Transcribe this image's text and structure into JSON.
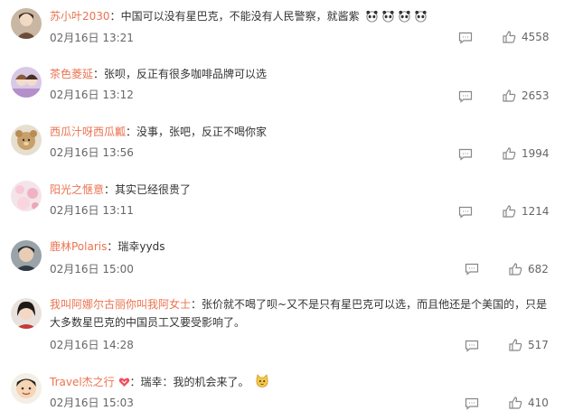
{
  "comments": [
    {
      "user": "苏小叶2030",
      "text": "中国可以没有星巴克，不能没有人民警察，就酱紫",
      "text2": "",
      "date": "02月16日 13:21",
      "likes": "4558",
      "emoji_count": 4,
      "emoji": "panda-emoji"
    },
    {
      "user": "茶色菱延",
      "text": "张呗，反正有很多咖啡品牌可以选",
      "text2": "",
      "date": "02月16日 13:12",
      "likes": "2653",
      "emoji_count": 0
    },
    {
      "user": "西瓜汁呀西瓜瓤",
      "text": "没事，张吧，反正不喝你家",
      "text2": "",
      "date": "02月16日 13:56",
      "likes": "1994",
      "emoji_count": 0
    },
    {
      "user": "阳光之惬意",
      "text": "其实已经很贵了",
      "text2": "",
      "date": "02月16日 13:11",
      "likes": "1214",
      "emoji_count": 0
    },
    {
      "user": "鹿林Polaris",
      "text": "瑞幸yyds",
      "text2": "",
      "date": "02月16日 15:00",
      "likes": "682",
      "emoji_count": 0
    },
    {
      "user": "我叫阿娜尔古丽你叫我阿女士",
      "text": "张价就不喝了呗~又不是只有星巴克可以选，而且他还是个美国的，只是",
      "text2": "大多数星巴克的中国员工又要受影响了。",
      "date": "02月16日 14:28",
      "likes": "517",
      "emoji_count": 0
    },
    {
      "user": "Travel杰之行",
      "text": "瑞幸：我的机会来了。",
      "text2": "",
      "date": "02月16日 15:03",
      "likes": "410",
      "emoji_count": 1,
      "emoji": "cat-emoji",
      "badge": "vip-heart-badge"
    }
  ],
  "separator": "：",
  "icons": {
    "reply": "comment-icon",
    "like": "thumbs-up-icon"
  },
  "colors": {
    "username": "#eb7350",
    "text": "#333333",
    "meta": "#666666"
  }
}
